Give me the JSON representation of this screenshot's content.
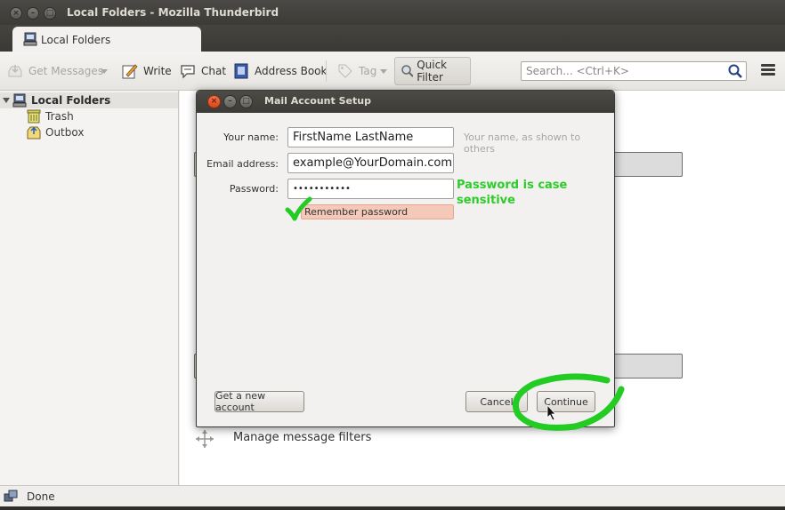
{
  "window": {
    "title": "Local Folders - Mozilla Thunderbird"
  },
  "tab": {
    "label": "Local Folders"
  },
  "toolbar": {
    "get_messages": "Get Messages",
    "write": "Write",
    "chat": "Chat",
    "address_book": "Address Book",
    "tag": "Tag",
    "quick_filter": "Quick Filter",
    "search_placeholder": "Search... <Ctrl+K>"
  },
  "folders": {
    "root": "Local Folders",
    "items": [
      {
        "label": "Trash",
        "icon": "trash-icon"
      },
      {
        "label": "Outbox",
        "icon": "outbox-icon"
      }
    ]
  },
  "content": {
    "manage_filters": "Manage message filters"
  },
  "status": {
    "text": "Done"
  },
  "dialog": {
    "title": "Mail Account Setup",
    "name_label": "Your name:",
    "name_value": "FirstName LastName",
    "name_hint": "Your name, as shown to others",
    "email_label": "Email address:",
    "email_value": "example@YourDomain.com",
    "password_label": "Password:",
    "password_value": "•••••••••••",
    "password_note": "Password is case sensitive",
    "remember_label": "Remember password",
    "remember_checked": true,
    "get_account_button": "Get a new account",
    "cancel_button": "Cancel",
    "continue_button": "Continue"
  },
  "colors": {
    "annotation_green": "#22cc22",
    "titlebar": "#3c3b37",
    "close_button": "#e95420"
  }
}
